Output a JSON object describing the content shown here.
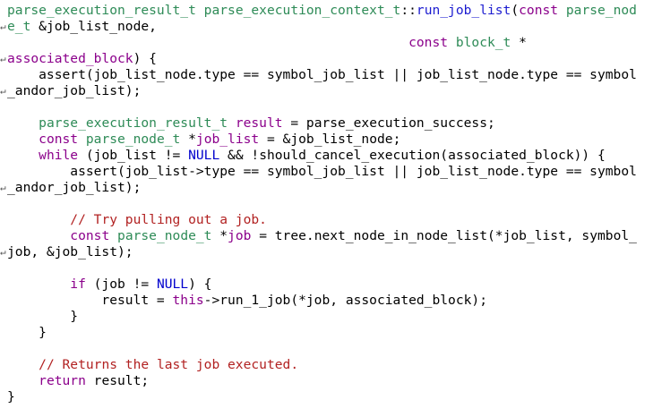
{
  "colors": {
    "type": "#2e8b57",
    "keyword": "#8b008b",
    "function": "#1c1cd0",
    "param": "#8b008b",
    "comment": "#b22222",
    "constant": "#0000cd",
    "plain": "#000000",
    "wrap_marker": "#555555"
  },
  "wrap_marker_icon": "line-wrap-icon",
  "lines": [
    {
      "wrap": false,
      "tokens": [
        {
          "t": "parse_execution_result_t",
          "c": "type"
        },
        {
          "t": " ",
          "c": "plain"
        },
        {
          "t": "parse_execution_context_t",
          "c": "type"
        },
        {
          "t": "::",
          "c": "plain"
        },
        {
          "t": "run_job_list",
          "c": "function"
        },
        {
          "t": "(",
          "c": "plain"
        },
        {
          "t": "const",
          "c": "keyword"
        },
        {
          "t": " ",
          "c": "plain"
        },
        {
          "t": "parse_nod",
          "c": "type"
        }
      ]
    },
    {
      "wrap": true,
      "tokens": [
        {
          "t": "e_t",
          "c": "type"
        },
        {
          "t": " &job_list_node,",
          "c": "plain"
        }
      ]
    },
    {
      "wrap": false,
      "tokens": [
        {
          "t": "                                                   ",
          "c": "plain"
        },
        {
          "t": "const",
          "c": "keyword"
        },
        {
          "t": " ",
          "c": "plain"
        },
        {
          "t": "block_t",
          "c": "type"
        },
        {
          "t": " *",
          "c": "plain"
        }
      ]
    },
    {
      "wrap": true,
      "tokens": [
        {
          "t": "associated_block",
          "c": "param"
        },
        {
          "t": ") {",
          "c": "plain"
        }
      ]
    },
    {
      "wrap": false,
      "tokens": [
        {
          "t": "    assert(job_list_node.type == symbol_job_list || job_list_node.type == symbol",
          "c": "plain"
        }
      ]
    },
    {
      "wrap": true,
      "tokens": [
        {
          "t": "_andor_job_list);",
          "c": "plain"
        }
      ]
    },
    {
      "wrap": false,
      "tokens": []
    },
    {
      "wrap": false,
      "tokens": [
        {
          "t": "    ",
          "c": "plain"
        },
        {
          "t": "parse_execution_result_t",
          "c": "type"
        },
        {
          "t": " ",
          "c": "plain"
        },
        {
          "t": "result",
          "c": "param"
        },
        {
          "t": " = parse_execution_success;",
          "c": "plain"
        }
      ]
    },
    {
      "wrap": false,
      "tokens": [
        {
          "t": "    ",
          "c": "plain"
        },
        {
          "t": "const",
          "c": "keyword"
        },
        {
          "t": " ",
          "c": "plain"
        },
        {
          "t": "parse_node_t",
          "c": "type"
        },
        {
          "t": " *",
          "c": "plain"
        },
        {
          "t": "job_list",
          "c": "param"
        },
        {
          "t": " = &job_list_node;",
          "c": "plain"
        }
      ]
    },
    {
      "wrap": false,
      "tokens": [
        {
          "t": "    ",
          "c": "plain"
        },
        {
          "t": "while",
          "c": "keyword"
        },
        {
          "t": " (job_list != ",
          "c": "plain"
        },
        {
          "t": "NULL",
          "c": "constant"
        },
        {
          "t": " && !should_cancel_execution(associated_block)) {",
          "c": "plain"
        }
      ]
    },
    {
      "wrap": false,
      "tokens": [
        {
          "t": "        assert(job_list->type == symbol_job_list || job_list_node.type == symbol",
          "c": "plain"
        }
      ]
    },
    {
      "wrap": true,
      "tokens": [
        {
          "t": "_andor_job_list);",
          "c": "plain"
        }
      ]
    },
    {
      "wrap": false,
      "tokens": []
    },
    {
      "wrap": false,
      "tokens": [
        {
          "t": "        ",
          "c": "plain"
        },
        {
          "t": "// Try pulling out a job.",
          "c": "comment"
        }
      ]
    },
    {
      "wrap": false,
      "tokens": [
        {
          "t": "        ",
          "c": "plain"
        },
        {
          "t": "const",
          "c": "keyword"
        },
        {
          "t": " ",
          "c": "plain"
        },
        {
          "t": "parse_node_t",
          "c": "type"
        },
        {
          "t": " *",
          "c": "plain"
        },
        {
          "t": "job",
          "c": "param"
        },
        {
          "t": " = tree.next_node_in_node_list(*job_list, symbol_",
          "c": "plain"
        }
      ]
    },
    {
      "wrap": true,
      "tokens": [
        {
          "t": "job, &job_list);",
          "c": "plain"
        }
      ]
    },
    {
      "wrap": false,
      "tokens": []
    },
    {
      "wrap": false,
      "tokens": [
        {
          "t": "        ",
          "c": "plain"
        },
        {
          "t": "if",
          "c": "keyword"
        },
        {
          "t": " (job != ",
          "c": "plain"
        },
        {
          "t": "NULL",
          "c": "constant"
        },
        {
          "t": ") {",
          "c": "plain"
        }
      ]
    },
    {
      "wrap": false,
      "tokens": [
        {
          "t": "            result = ",
          "c": "plain"
        },
        {
          "t": "this",
          "c": "keyword"
        },
        {
          "t": "->run_1_job(*job, associated_block);",
          "c": "plain"
        }
      ]
    },
    {
      "wrap": false,
      "tokens": [
        {
          "t": "        }",
          "c": "plain"
        }
      ]
    },
    {
      "wrap": false,
      "tokens": [
        {
          "t": "    }",
          "c": "plain"
        }
      ]
    },
    {
      "wrap": false,
      "tokens": []
    },
    {
      "wrap": false,
      "tokens": [
        {
          "t": "    ",
          "c": "plain"
        },
        {
          "t": "// Returns the last job executed.",
          "c": "comment"
        }
      ]
    },
    {
      "wrap": false,
      "tokens": [
        {
          "t": "    ",
          "c": "plain"
        },
        {
          "t": "return",
          "c": "keyword"
        },
        {
          "t": " result;",
          "c": "plain"
        }
      ]
    },
    {
      "wrap": false,
      "tokens": [
        {
          "t": "}",
          "c": "plain"
        }
      ]
    }
  ]
}
